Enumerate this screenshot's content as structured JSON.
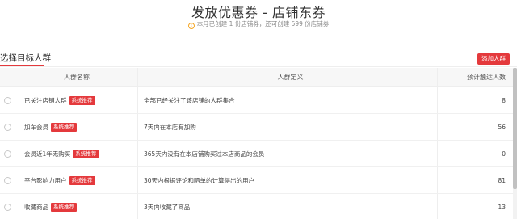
{
  "header": {
    "title": "发放优惠券 - 店铺东券",
    "notice": "本月已创建 1 份店铺券，还可创建 599 份店铺券",
    "notice_icon": "info-icon"
  },
  "section": {
    "title": "选择目标人群",
    "add_button_label": "添加人群"
  },
  "table": {
    "columns": [
      "人群名称",
      "人群定义",
      "预计触达人数"
    ],
    "rows": [
      {
        "name": "已关注店铺人群",
        "tag": "系统推荐",
        "definition": "全部已经关注了该店铺的人群集合",
        "count": "8"
      },
      {
        "name": "加车会员",
        "tag": "系统推荐",
        "definition": "7天内在本店有加购",
        "count": "56"
      },
      {
        "name": "会员近1年无购买",
        "tag": "系统推荐",
        "definition": "365天内没有在本店铺购买过本店商品的会员",
        "count": "0"
      },
      {
        "name": "平台影响力用户",
        "tag": "系统推荐",
        "definition": "30天内根据评论和晒单的计算得出的用户",
        "count": "81"
      },
      {
        "name": "收藏商品",
        "tag": "系统推荐",
        "definition": "3天内收藏了商品",
        "count": "13"
      }
    ]
  },
  "colors": {
    "accent": "#e4393c",
    "header_bg": "#f7f7f7",
    "notice_icon": "#f5a623"
  }
}
